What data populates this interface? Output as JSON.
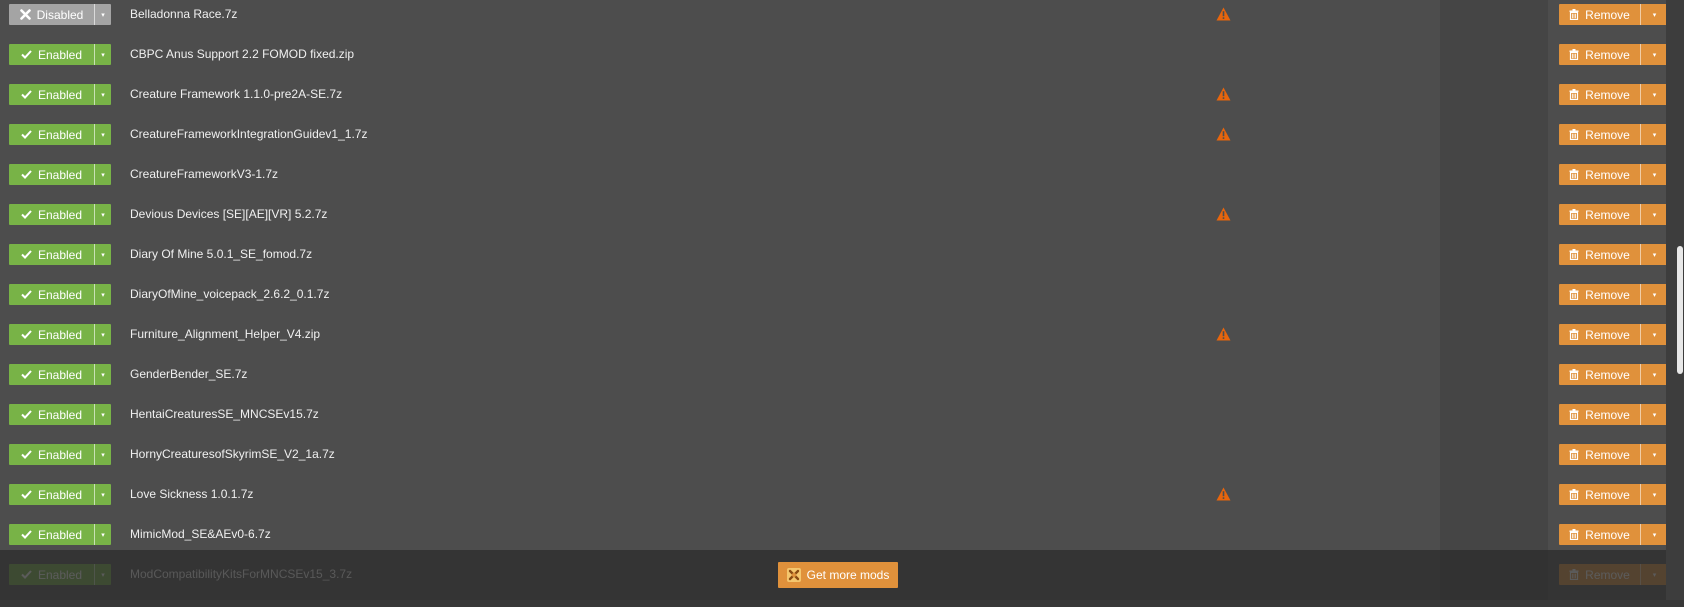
{
  "colors": {
    "enabled": "#78b347",
    "disabled": "#a4a4a4",
    "accent": "#e0913b",
    "background": "#4d4d4d",
    "warning": "#e8650c"
  },
  "icons": {
    "enabled": "check-icon",
    "disabled": "x-icon",
    "warning": "warning-icon",
    "remove": "trash-icon",
    "dropdown": "caret-down-icon",
    "get_more": "nexus-logo-icon"
  },
  "labels": {
    "remove": "Remove",
    "dropdown": "▾"
  },
  "mods": [
    {
      "status": "Disabled",
      "name": "Belladonna Race.7z",
      "warning": true
    },
    {
      "status": "Enabled",
      "name": "CBPC Anus Support 2.2 FOMOD fixed.zip",
      "warning": false
    },
    {
      "status": "Enabled",
      "name": "Creature Framework 1.1.0-pre2A-SE.7z",
      "warning": true
    },
    {
      "status": "Enabled",
      "name": "CreatureFrameworkIntegrationGuidev1_1.7z",
      "warning": true
    },
    {
      "status": "Enabled",
      "name": "CreatureFrameworkV3-1.7z",
      "warning": false
    },
    {
      "status": "Enabled",
      "name": "Devious Devices [SE][AE][VR] 5.2.7z",
      "warning": true
    },
    {
      "status": "Enabled",
      "name": "Diary Of Mine 5.0.1_SE_fomod.7z",
      "warning": false
    },
    {
      "status": "Enabled",
      "name": "DiaryOfMine_voicepack_2.6.2_0.1.7z",
      "warning": false
    },
    {
      "status": "Enabled",
      "name": "Furniture_Alignment_Helper_V4.zip",
      "warning": true
    },
    {
      "status": "Enabled",
      "name": "GenderBender_SE.7z",
      "warning": false
    },
    {
      "status": "Enabled",
      "name": "HentaiCreaturesSE_MNCSEv15.7z",
      "warning": false
    },
    {
      "status": "Enabled",
      "name": "HornyCreaturesofSkyrimSE_V2_1a.7z",
      "warning": false
    },
    {
      "status": "Enabled",
      "name": "Love Sickness 1.0.1.7z",
      "warning": true
    },
    {
      "status": "Enabled",
      "name": "MimicMod_SE&AEv0-6.7z",
      "warning": false
    },
    {
      "status": "Enabled",
      "name": "ModCompatibilityKitsForMNCSEv15_3.7z",
      "warning": false
    }
  ],
  "get_more_label": "Get more mods"
}
